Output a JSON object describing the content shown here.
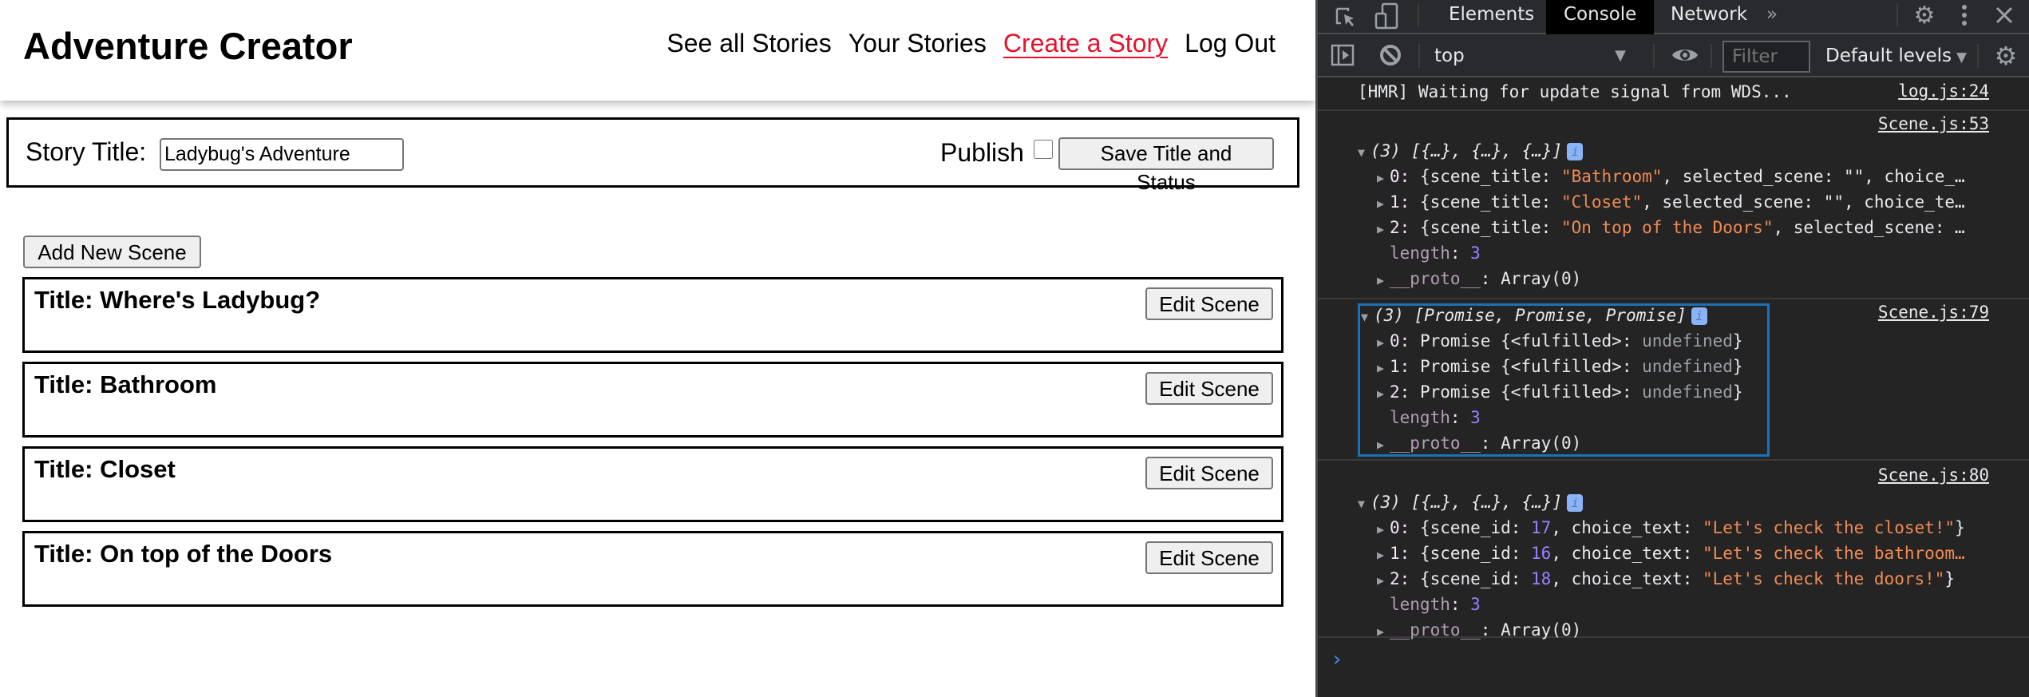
{
  "app": {
    "brand": "Adventure Creator",
    "nav": [
      {
        "label": "See all Stories",
        "active": false
      },
      {
        "label": "Your Stories",
        "active": false
      },
      {
        "label": "Create a Story",
        "active": true
      },
      {
        "label": "Log Out",
        "active": false
      }
    ],
    "active_color": "#e8102a",
    "story_form": {
      "title_label": "Story Title:",
      "title_value": "Ladybug's Adventure",
      "publish_label": "Publish",
      "publish_checked": false,
      "save_label": "Save Title and Status"
    },
    "add_scene_label": "Add New Scene",
    "scenes": [
      {
        "title": "Title: Where's Ladybug?",
        "edit_label": "Edit Scene"
      },
      {
        "title": "Title: Bathroom",
        "edit_label": "Edit Scene"
      },
      {
        "title": "Title: Closet",
        "edit_label": "Edit Scene"
      },
      {
        "title": "Title: On top of the Doors",
        "edit_label": "Edit Scene"
      }
    ]
  },
  "devtools": {
    "tabs": [
      {
        "label": "Elements",
        "active": false
      },
      {
        "label": "Console",
        "active": true
      },
      {
        "label": "Network",
        "active": false
      }
    ],
    "more_tabs_icon": "»",
    "icons": {
      "inspect": "inspect-element-icon",
      "device": "device-toolbar-icon",
      "settings": "gear-icon",
      "menu": "kebab-menu-icon",
      "close": "close-icon",
      "sidebar": "sidebar-toggle-icon",
      "clear": "clear-console-icon",
      "eye": "live-expression-icon"
    },
    "context": "top",
    "filter_placeholder": "Filter",
    "levels": "Default levels",
    "messages": [
      {
        "source": "log.js:24",
        "text": "[HMR] Waiting for update signal from WDS..."
      },
      {
        "source": "Scene.js:53",
        "summary": "(3) [{…}, {…}, {…}]",
        "entries": [
          {
            "index": "0",
            "key": "scene_title",
            "value": "\"Bathroom\"",
            "rest": ", selected_scene: \"\", choice_…"
          },
          {
            "index": "1",
            "key": "scene_title",
            "value": "\"Closet\"",
            "rest": ", selected_scene: \"\", choice_te…"
          },
          {
            "index": "2",
            "key": "scene_title",
            "value": "\"On top of the Doors\"",
            "rest": ", selected_scene: …"
          }
        ],
        "length": "3",
        "proto": "Array(0)"
      },
      {
        "source": "Scene.js:79",
        "summary": "(3) [Promise, Promise, Promise]",
        "entries": [
          {
            "index": "0",
            "label": "Promise {<fulfilled>: ",
            "value": "undefined",
            "close": "}"
          },
          {
            "index": "1",
            "label": "Promise {<fulfilled>: ",
            "value": "undefined",
            "close": "}"
          },
          {
            "index": "2",
            "label": "Promise {<fulfilled>: ",
            "value": "undefined",
            "close": "}"
          }
        ],
        "length": "3",
        "proto": "Array(0)"
      },
      {
        "source": "Scene.js:80",
        "summary": "(3) [{…}, {…}, {…}]",
        "entries": [
          {
            "index": "0",
            "scene_id": "17",
            "choice_text": "\"Let's check the closet!\"",
            "close": "}"
          },
          {
            "index": "1",
            "scene_id": "16",
            "choice_text": "\"Let's check the bathroom…",
            "close": ""
          },
          {
            "index": "2",
            "scene_id": "18",
            "choice_text": "\"Let's check the doors!\"",
            "close": "}"
          }
        ],
        "length": "3",
        "proto": "Array(0)"
      }
    ],
    "prompt": "›"
  }
}
